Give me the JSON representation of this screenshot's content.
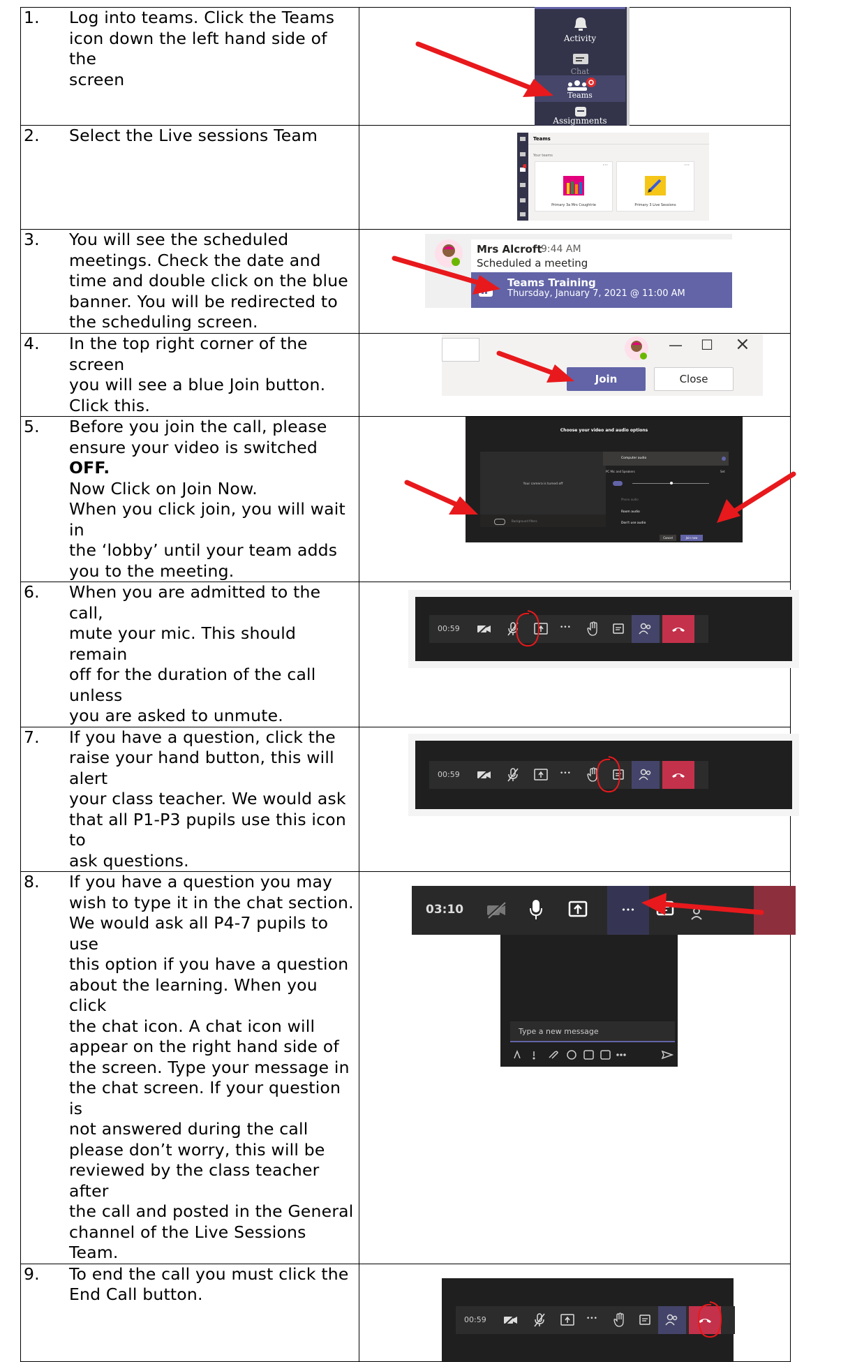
{
  "steps": [
    {
      "num": "1.",
      "lines": [
        "Log into teams.  Click the Teams",
        "icon down the left hand side of the",
        "screen"
      ]
    },
    {
      "num": "2.",
      "lines": [
        "Select the Live sessions Team"
      ]
    },
    {
      "num": "3.",
      "lines": [
        "You will see the scheduled",
        "meetings.  Check the date and",
        "time and double click on the blue",
        "banner.  You will be redirected to",
        "the scheduling screen."
      ]
    },
    {
      "num": "4.",
      "lines": [
        "In the top right corner of the screen",
        "you will see a blue Join button.",
        "Click this."
      ]
    },
    {
      "num": "5.",
      "lines": [
        " Before you join the call, please",
        "ensure your video is switched ",
        "Now Click on Join Now.",
        "When you click join, you will wait in",
        "the ‘lobby’ until your team adds",
        "you to the meeting."
      ],
      "bold": "OFF."
    },
    {
      "num": "6.",
      "lines": [
        "When you are admitted to the call,",
        "mute your mic.  This should remain",
        "off for the duration of the call unless",
        "you are asked to unmute."
      ]
    },
    {
      "num": "7.",
      "lines": [
        "If you have a question, click the",
        "raise your hand button, this will alert",
        "your class teacher.  We would ask",
        "that all P1-P3 pupils use this icon to",
        "ask questions."
      ]
    },
    {
      "num": "8.",
      "lines": [
        "If you have a question you may",
        "wish to type it in the chat section.",
        "We would ask all P4-7 pupils to use",
        "this option if you have a question",
        "about the learning.  When you click",
        "the chat icon. A chat icon will",
        "appear on the right hand side of",
        "the screen.  Type your message in",
        "the chat screen.  If your question is",
        "not answered during the call",
        "please don’t worry, this will be",
        "reviewed by the class teacher after",
        "the call and posted in the General",
        "channel of the Live Sessions Team."
      ]
    },
    {
      "num": "9.",
      "lines": [
        "To end the call you must click the",
        "End Call button."
      ]
    }
  ],
  "shot1": {
    "activity": "Activity",
    "chat": "Chat",
    "teams": "Teams",
    "assignments": "Assignments"
  },
  "shot2": {
    "header": "Teams",
    "section": "Your teams",
    "team_a": "Primary 3a Mrs Coughtrie",
    "team_b": "Primary 3 Live Sessions",
    "dots": "···"
  },
  "shot3": {
    "sender": "Mrs Alcroft",
    "time": "9:44 AM",
    "message": "Scheduled a meeting",
    "meeting_title": "Teams Training",
    "meeting_when": "Thursday, January 7, 2021 @ 11:00 AM"
  },
  "shot4": {
    "join": "Join",
    "close": "Close",
    "minimize": "—",
    "maximize": "☐",
    "close_x": "×"
  },
  "shot5": {
    "heading": "Choose your video and audio options",
    "camera_off": "Your camera is turned off",
    "background": "Background filters",
    "computer_audio": "Computer audio",
    "device": "PC Mic and Speakers",
    "device_setting": "Set",
    "phone_audio": "Phone audio",
    "room_audio": "Room audio",
    "dont_use_audio": "Don't use audio",
    "cancel": "Cancel",
    "join_now": "Join now"
  },
  "toolbar": {
    "time": "00:59",
    "more": "•••"
  },
  "shot8": {
    "time": "03:10",
    "more": "•••",
    "placeholder": "Type a new message"
  },
  "colors": {
    "teams_purple": "#6264a7",
    "arrow_red": "#e8191c",
    "hangup": "#c4314b",
    "dark_bg": "#292929"
  }
}
